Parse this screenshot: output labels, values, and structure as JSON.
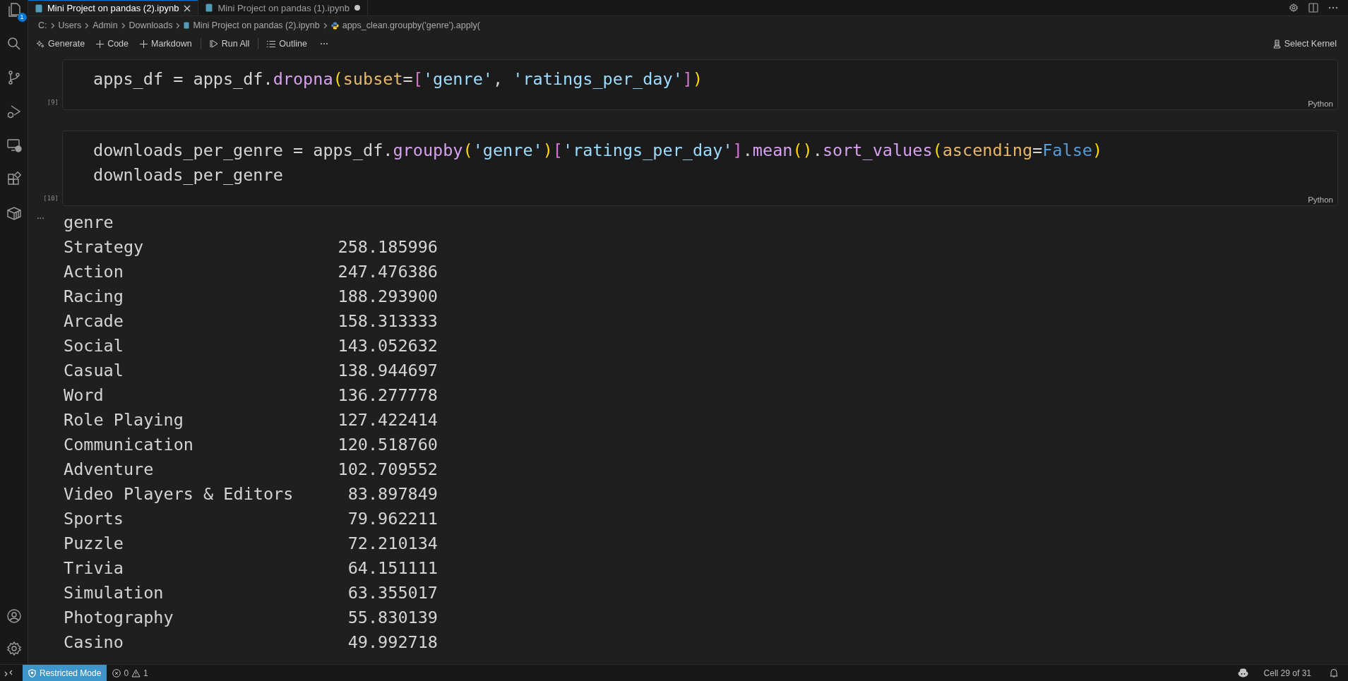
{
  "activity_bar": {
    "explorer_badge": "1"
  },
  "tabs": [
    {
      "label": "Mini Project on pandas (2).ipynb",
      "selected": true,
      "modified": false
    },
    {
      "label": "Mini Project on pandas (1).ipynb",
      "selected": false,
      "modified": true
    }
  ],
  "breadcrumb": [
    "C:",
    "Users",
    "Admin",
    "Downloads",
    "Mini Project on pandas (2).ipynb",
    "apps_clean.groupby('genre').apply("
  ],
  "toolbar": {
    "items": [
      "Generate",
      "Code",
      "Markdown",
      "Run All",
      "Outline"
    ],
    "kernel": "Select Kernel"
  },
  "cells": [
    {
      "execution_count": "[9]",
      "language": "Python",
      "lines": [
        [
          {
            "kind": "text",
            "t": "apps_df = apps_df."
          },
          {
            "kind": "method",
            "t": "dropna"
          },
          {
            "kind": "paren",
            "t": "("
          },
          {
            "kind": "param",
            "t": "subset"
          },
          {
            "kind": "text",
            "t": "="
          },
          {
            "kind": "bracket",
            "t": "["
          },
          {
            "kind": "string",
            "t": "'genre'"
          },
          {
            "kind": "text",
            "t": ", "
          },
          {
            "kind": "string",
            "t": "'ratings_per_day'"
          },
          {
            "kind": "bracket",
            "t": "]"
          },
          {
            "kind": "paren",
            "t": ")"
          }
        ]
      ]
    },
    {
      "execution_count": "[10]",
      "language": "Python",
      "lines": [
        [
          {
            "kind": "text",
            "t": "downloads_per_genre = apps_df."
          },
          {
            "kind": "method",
            "t": "groupby"
          },
          {
            "kind": "paren",
            "t": "("
          },
          {
            "kind": "string",
            "t": "'genre'"
          },
          {
            "kind": "paren",
            "t": ")"
          },
          {
            "kind": "bracket",
            "t": "["
          },
          {
            "kind": "string",
            "t": "'ratings_per_day'"
          },
          {
            "kind": "bracket",
            "t": "]"
          },
          {
            "kind": "text",
            "t": "."
          },
          {
            "kind": "method",
            "t": "mean"
          },
          {
            "kind": "paren",
            "t": "()"
          },
          {
            "kind": "text",
            "t": "."
          },
          {
            "kind": "method",
            "t": "sort_values"
          },
          {
            "kind": "paren",
            "t": "("
          },
          {
            "kind": "param",
            "t": "ascending"
          },
          {
            "kind": "text",
            "t": "="
          },
          {
            "kind": "constant",
            "t": "False"
          },
          {
            "kind": "paren",
            "t": ")"
          }
        ],
        [
          {
            "kind": "text",
            "t": "downloads_per_genre"
          }
        ]
      ]
    }
  ],
  "output": {
    "more": "...",
    "index_name": "genre",
    "rows": [
      {
        "label": "Strategy",
        "value": "258.185996"
      },
      {
        "label": "Action",
        "value": "247.476386"
      },
      {
        "label": "Racing",
        "value": "188.293900"
      },
      {
        "label": "Arcade",
        "value": "158.313333"
      },
      {
        "label": "Social",
        "value": "143.052632"
      },
      {
        "label": "Casual",
        "value": "138.944697"
      },
      {
        "label": "Word",
        "value": "136.277778"
      },
      {
        "label": "Role Playing",
        "value": "127.422414"
      },
      {
        "label": "Communication",
        "value": "120.518760"
      },
      {
        "label": "Adventure",
        "value": "102.709552"
      },
      {
        "label": "Video Players & Editors",
        "value": "83.897849"
      },
      {
        "label": "Sports",
        "value": "79.962211"
      },
      {
        "label": "Puzzle",
        "value": "72.210134"
      },
      {
        "label": "Trivia",
        "value": "64.151111"
      },
      {
        "label": "Simulation",
        "value": "63.355017"
      },
      {
        "label": "Photography",
        "value": "55.830139"
      },
      {
        "label": "Casino",
        "value": "49.992718"
      }
    ]
  },
  "status_bar": {
    "mode": "Restricted Mode",
    "errors": "0",
    "warnings": "1",
    "cell": "Cell 29 of 31"
  }
}
